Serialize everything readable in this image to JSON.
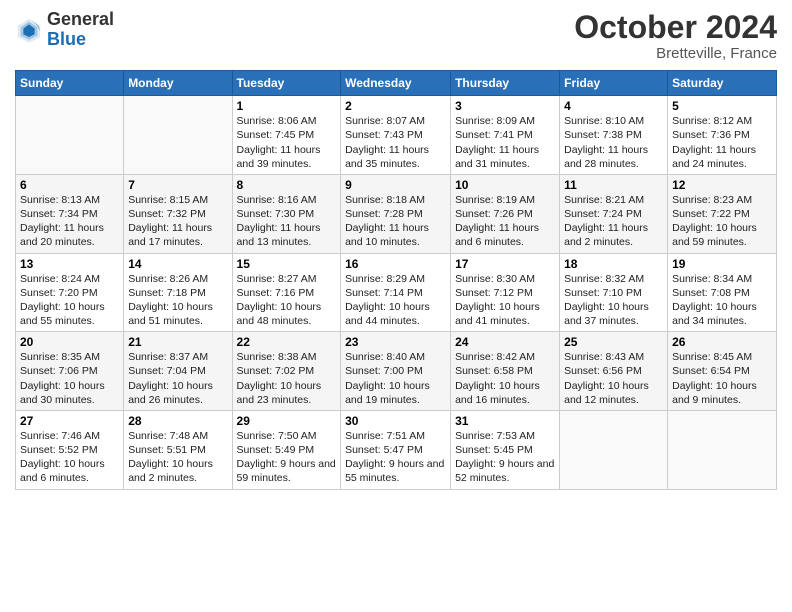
{
  "header": {
    "logo_line1": "General",
    "logo_line2": "Blue",
    "title": "October 2024",
    "subtitle": "Bretteville, France"
  },
  "days_of_week": [
    "Sunday",
    "Monday",
    "Tuesday",
    "Wednesday",
    "Thursday",
    "Friday",
    "Saturday"
  ],
  "weeks": [
    [
      {
        "day": "",
        "sunrise": "",
        "sunset": "",
        "daylight": ""
      },
      {
        "day": "",
        "sunrise": "",
        "sunset": "",
        "daylight": ""
      },
      {
        "day": "1",
        "sunrise": "Sunrise: 8:06 AM",
        "sunset": "Sunset: 7:45 PM",
        "daylight": "Daylight: 11 hours and 39 minutes."
      },
      {
        "day": "2",
        "sunrise": "Sunrise: 8:07 AM",
        "sunset": "Sunset: 7:43 PM",
        "daylight": "Daylight: 11 hours and 35 minutes."
      },
      {
        "day": "3",
        "sunrise": "Sunrise: 8:09 AM",
        "sunset": "Sunset: 7:41 PM",
        "daylight": "Daylight: 11 hours and 31 minutes."
      },
      {
        "day": "4",
        "sunrise": "Sunrise: 8:10 AM",
        "sunset": "Sunset: 7:38 PM",
        "daylight": "Daylight: 11 hours and 28 minutes."
      },
      {
        "day": "5",
        "sunrise": "Sunrise: 8:12 AM",
        "sunset": "Sunset: 7:36 PM",
        "daylight": "Daylight: 11 hours and 24 minutes."
      }
    ],
    [
      {
        "day": "6",
        "sunrise": "Sunrise: 8:13 AM",
        "sunset": "Sunset: 7:34 PM",
        "daylight": "Daylight: 11 hours and 20 minutes."
      },
      {
        "day": "7",
        "sunrise": "Sunrise: 8:15 AM",
        "sunset": "Sunset: 7:32 PM",
        "daylight": "Daylight: 11 hours and 17 minutes."
      },
      {
        "day": "8",
        "sunrise": "Sunrise: 8:16 AM",
        "sunset": "Sunset: 7:30 PM",
        "daylight": "Daylight: 11 hours and 13 minutes."
      },
      {
        "day": "9",
        "sunrise": "Sunrise: 8:18 AM",
        "sunset": "Sunset: 7:28 PM",
        "daylight": "Daylight: 11 hours and 10 minutes."
      },
      {
        "day": "10",
        "sunrise": "Sunrise: 8:19 AM",
        "sunset": "Sunset: 7:26 PM",
        "daylight": "Daylight: 11 hours and 6 minutes."
      },
      {
        "day": "11",
        "sunrise": "Sunrise: 8:21 AM",
        "sunset": "Sunset: 7:24 PM",
        "daylight": "Daylight: 11 hours and 2 minutes."
      },
      {
        "day": "12",
        "sunrise": "Sunrise: 8:23 AM",
        "sunset": "Sunset: 7:22 PM",
        "daylight": "Daylight: 10 hours and 59 minutes."
      }
    ],
    [
      {
        "day": "13",
        "sunrise": "Sunrise: 8:24 AM",
        "sunset": "Sunset: 7:20 PM",
        "daylight": "Daylight: 10 hours and 55 minutes."
      },
      {
        "day": "14",
        "sunrise": "Sunrise: 8:26 AM",
        "sunset": "Sunset: 7:18 PM",
        "daylight": "Daylight: 10 hours and 51 minutes."
      },
      {
        "day": "15",
        "sunrise": "Sunrise: 8:27 AM",
        "sunset": "Sunset: 7:16 PM",
        "daylight": "Daylight: 10 hours and 48 minutes."
      },
      {
        "day": "16",
        "sunrise": "Sunrise: 8:29 AM",
        "sunset": "Sunset: 7:14 PM",
        "daylight": "Daylight: 10 hours and 44 minutes."
      },
      {
        "day": "17",
        "sunrise": "Sunrise: 8:30 AM",
        "sunset": "Sunset: 7:12 PM",
        "daylight": "Daylight: 10 hours and 41 minutes."
      },
      {
        "day": "18",
        "sunrise": "Sunrise: 8:32 AM",
        "sunset": "Sunset: 7:10 PM",
        "daylight": "Daylight: 10 hours and 37 minutes."
      },
      {
        "day": "19",
        "sunrise": "Sunrise: 8:34 AM",
        "sunset": "Sunset: 7:08 PM",
        "daylight": "Daylight: 10 hours and 34 minutes."
      }
    ],
    [
      {
        "day": "20",
        "sunrise": "Sunrise: 8:35 AM",
        "sunset": "Sunset: 7:06 PM",
        "daylight": "Daylight: 10 hours and 30 minutes."
      },
      {
        "day": "21",
        "sunrise": "Sunrise: 8:37 AM",
        "sunset": "Sunset: 7:04 PM",
        "daylight": "Daylight: 10 hours and 26 minutes."
      },
      {
        "day": "22",
        "sunrise": "Sunrise: 8:38 AM",
        "sunset": "Sunset: 7:02 PM",
        "daylight": "Daylight: 10 hours and 23 minutes."
      },
      {
        "day": "23",
        "sunrise": "Sunrise: 8:40 AM",
        "sunset": "Sunset: 7:00 PM",
        "daylight": "Daylight: 10 hours and 19 minutes."
      },
      {
        "day": "24",
        "sunrise": "Sunrise: 8:42 AM",
        "sunset": "Sunset: 6:58 PM",
        "daylight": "Daylight: 10 hours and 16 minutes."
      },
      {
        "day": "25",
        "sunrise": "Sunrise: 8:43 AM",
        "sunset": "Sunset: 6:56 PM",
        "daylight": "Daylight: 10 hours and 12 minutes."
      },
      {
        "day": "26",
        "sunrise": "Sunrise: 8:45 AM",
        "sunset": "Sunset: 6:54 PM",
        "daylight": "Daylight: 10 hours and 9 minutes."
      }
    ],
    [
      {
        "day": "27",
        "sunrise": "Sunrise: 7:46 AM",
        "sunset": "Sunset: 5:52 PM",
        "daylight": "Daylight: 10 hours and 6 minutes."
      },
      {
        "day": "28",
        "sunrise": "Sunrise: 7:48 AM",
        "sunset": "Sunset: 5:51 PM",
        "daylight": "Daylight: 10 hours and 2 minutes."
      },
      {
        "day": "29",
        "sunrise": "Sunrise: 7:50 AM",
        "sunset": "Sunset: 5:49 PM",
        "daylight": "Daylight: 9 hours and 59 minutes."
      },
      {
        "day": "30",
        "sunrise": "Sunrise: 7:51 AM",
        "sunset": "Sunset: 5:47 PM",
        "daylight": "Daylight: 9 hours and 55 minutes."
      },
      {
        "day": "31",
        "sunrise": "Sunrise: 7:53 AM",
        "sunset": "Sunset: 5:45 PM",
        "daylight": "Daylight: 9 hours and 52 minutes."
      },
      {
        "day": "",
        "sunrise": "",
        "sunset": "",
        "daylight": ""
      },
      {
        "day": "",
        "sunrise": "",
        "sunset": "",
        "daylight": ""
      }
    ]
  ]
}
